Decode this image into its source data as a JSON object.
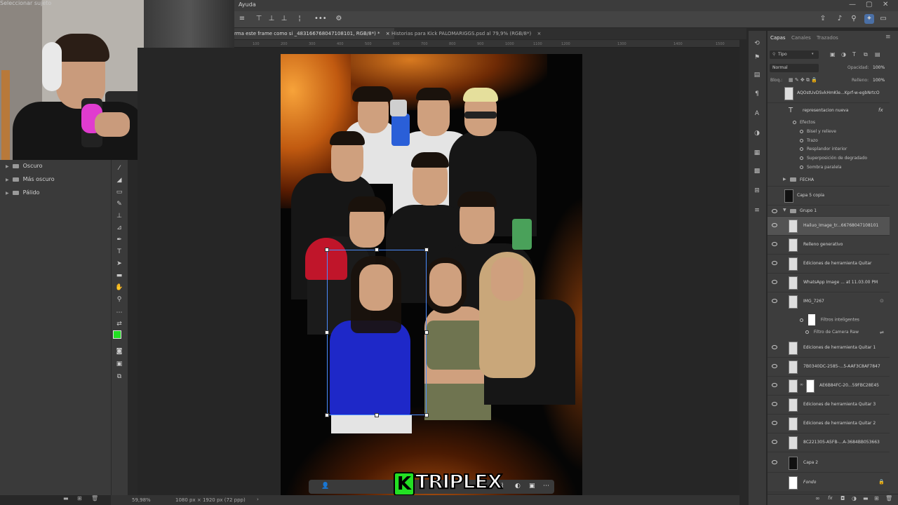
{
  "menubar": {
    "menu_help": "Ayuda",
    "minimize": "—",
    "maximize": "▢",
    "close": "✕"
  },
  "tabs": [
    {
      "label": "rma este frame como si _483166768047108101, RGB/8*) *",
      "close": "×"
    },
    {
      "label": "Historias para Kick PALOMARIGGS.psd al 79,9% (RGB/8*)",
      "close": "×"
    }
  ],
  "ruler_ticks": [
    "100",
    "200",
    "300",
    "400",
    "500",
    "600",
    "700",
    "800",
    "900",
    "1000",
    "1100",
    "1200",
    "1300",
    "1400",
    "1500"
  ],
  "presets_panel": {
    "items": [
      "Oscuro",
      "Más oscuro",
      "Pálido"
    ]
  },
  "taskbar": {
    "select_subject": "Seleccionar sujeto"
  },
  "logo": {
    "k": "K",
    "text": "TRIPLEX"
  },
  "statusbar": {
    "zoom": "59,98%",
    "doc_size": "1080 px × 1920 px (72 ppp)",
    "arrow": "›"
  },
  "layers_panel": {
    "tabs": [
      "Capas",
      "Canales",
      "Trazados"
    ],
    "filter": "Tipo",
    "blend_mode": "Normal",
    "opacity_label": "Opacidad:",
    "opacity_value": "100%",
    "lock_label": "Bloq.:",
    "fill_label": "Relleno:",
    "fill_value": "100%",
    "layers": [
      {
        "name": "AQOstUvDSvkHmKle...Kprf-w-egbNrtcO"
      },
      {
        "name": "representacion nueva",
        "fx": "fx"
      },
      {
        "name": "FECHA"
      },
      {
        "name": "Capa 5 copia"
      },
      {
        "name": "Grupo 1"
      },
      {
        "name": "Hailuo_Image_tr...66768047108101"
      },
      {
        "name": "Relleno generativo"
      },
      {
        "name": "Ediciones de herramienta Quitar"
      },
      {
        "name": "WhatsApp Image ... at 11.03.00 PM"
      },
      {
        "name": "IMG_7267"
      },
      {
        "name": "Ediciones de herramienta Quitar 1"
      },
      {
        "name": "7B0340DC-2585-...5-AAF3C8AF7847"
      },
      {
        "name": "AE6B84FC-20...59FBC28E45"
      },
      {
        "name": "Ediciones de herramienta Quitar 3"
      },
      {
        "name": "Ediciones de herramienta Quitar 2"
      },
      {
        "name": "8C221305-A5FB-...A-3684BB053663"
      },
      {
        "name": "Capa 2"
      },
      {
        "name": "Fondo"
      }
    ],
    "effects": {
      "header": "Efectos",
      "items": [
        "Bisel y relieve",
        "Trazo",
        "Resplandor interior",
        "Superposición de degradado",
        "Sombra paralela"
      ]
    },
    "smart_filters": {
      "header": "Filtros inteligentes",
      "item": "Filtro de Camera Raw"
    }
  }
}
